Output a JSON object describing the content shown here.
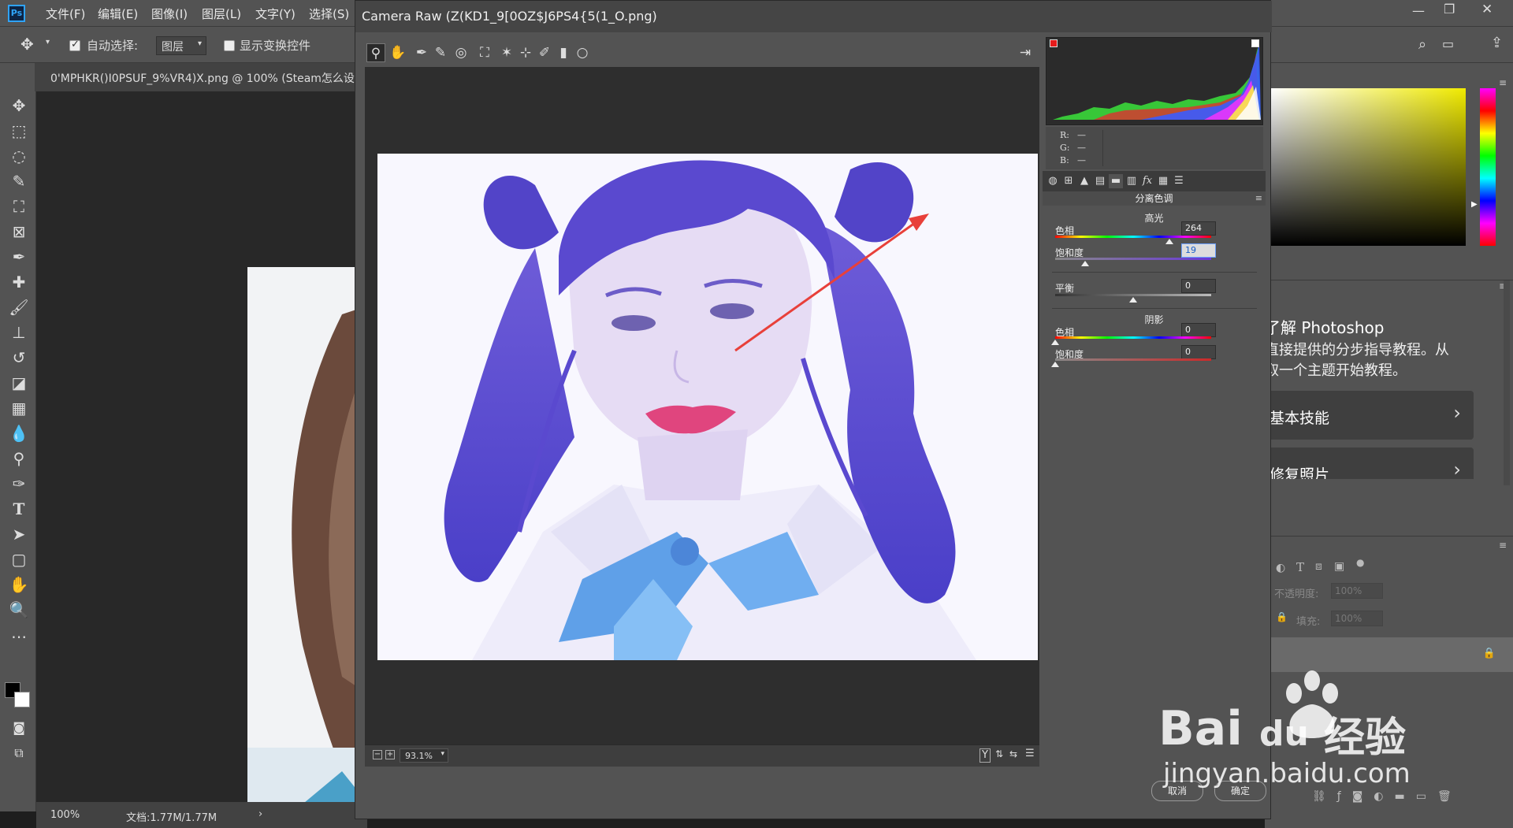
{
  "ps": {
    "logo": "Ps",
    "menu": [
      "文件(F)",
      "编辑(E)",
      "图像(I)",
      "图层(L)",
      "文字(Y)",
      "选择(S)"
    ],
    "options": {
      "auto_select_label": "自动选择:",
      "auto_select_value": "图层",
      "show_transform_label": "显示变换控件"
    },
    "doc_tab": "0'MPHKR()I0PSUF_9%VR4)X.png @ 100% (Steam怎么设",
    "status": {
      "zoom": "100%",
      "doc_size": "文档:1.77M/1.77M"
    },
    "learn": {
      "title": "了解 Photoshop",
      "desc": "直接提供的分步指导教程。从取一个主题开始教程。",
      "items": [
        "基本技能",
        "修复照片"
      ]
    },
    "layers": {
      "opacity_label": "不透明度:",
      "opacity_value": "100%",
      "fill_label": "填充:",
      "fill_value": "100%"
    }
  },
  "camera_raw": {
    "title": "Camera Raw (Z(KD1_9[0OZ$J6PS4{5(1_O.png)",
    "zoom_value": "93.1%",
    "rgb": {
      "r_label": "R:",
      "g_label": "G:",
      "b_label": "B:",
      "r": "—",
      "g": "—",
      "b": "—"
    },
    "panel_title": "分离色调",
    "highlights": {
      "title": "高光",
      "hue_label": "色相",
      "hue_value": "264",
      "hue_pos": 0.733,
      "sat_label": "饱和度",
      "sat_value": "19",
      "sat_pos": 0.19
    },
    "balance": {
      "label": "平衡",
      "value": "0",
      "pos": 0.5
    },
    "shadows": {
      "title": "阴影",
      "hue_label": "色相",
      "hue_value": "0",
      "hue_pos": 0,
      "sat_label": "饱和度",
      "sat_value": "0",
      "sat_pos": 0
    },
    "buttons": {
      "cancel": "取消",
      "ok": "确定"
    }
  },
  "watermark": {
    "brand": "Bai",
    "brand2": "du",
    "brand_cn": "经验",
    "url": "jingyan.baidu.com"
  },
  "colors": {
    "accent_red_arrow": "#e8403a",
    "photo_tint": "#8a7ee0"
  }
}
